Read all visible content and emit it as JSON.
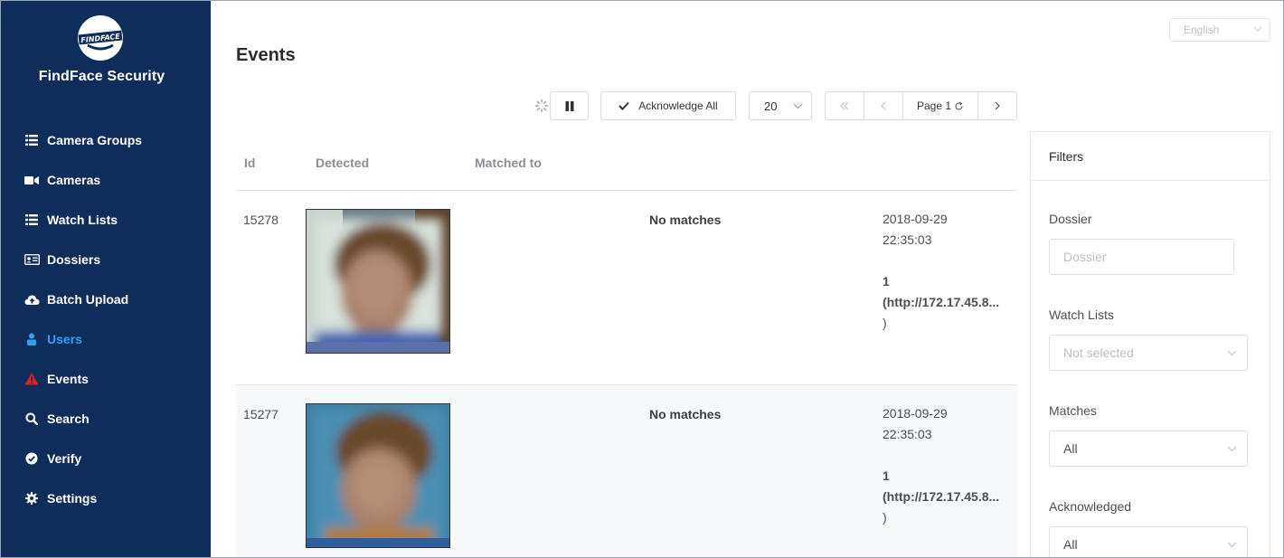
{
  "app": {
    "brand": "FindFace Security",
    "logo_text": "FINDFACE"
  },
  "sidebar": {
    "items": [
      {
        "label": "Camera Groups",
        "icon": "list-icon"
      },
      {
        "label": "Cameras",
        "icon": "video-camera-icon"
      },
      {
        "label": "Watch Lists",
        "icon": "list-icon"
      },
      {
        "label": "Dossiers",
        "icon": "id-card-icon"
      },
      {
        "label": "Batch Upload",
        "icon": "cloud-upload-icon"
      },
      {
        "label": "Users",
        "icon": "user-icon",
        "active": true
      },
      {
        "label": "Events",
        "icon": "warning-icon"
      },
      {
        "label": "Search",
        "icon": "search-icon"
      },
      {
        "label": "Verify",
        "icon": "check-circle-icon"
      },
      {
        "label": "Settings",
        "icon": "gear-icon"
      }
    ]
  },
  "header": {
    "title": "Events",
    "language": "English"
  },
  "toolbar": {
    "acknowledge_all": "Acknowledge All",
    "page_size": "20",
    "page_label": "Page 1"
  },
  "table": {
    "columns": [
      "Id",
      "Detected",
      "Matched to"
    ],
    "rows": [
      {
        "id": "15278",
        "match": "No matches",
        "date": "2018-09-29",
        "time": "22:35:03",
        "camera_id": "1",
        "camera_url": "(http://172.17.45.8...",
        "camera_close": ")"
      },
      {
        "id": "15277",
        "match": "No matches",
        "date": "2018-09-29",
        "time": "22:35:03",
        "camera_id": "1",
        "camera_url": "(http://172.17.45.8...",
        "camera_close": ")"
      }
    ]
  },
  "filters": {
    "title": "Filters",
    "dossier": {
      "label": "Dossier",
      "placeholder": "Dossier"
    },
    "watch_lists": {
      "label": "Watch Lists",
      "value": "Not selected"
    },
    "matches": {
      "label": "Matches",
      "value": "All"
    },
    "acknowledged": {
      "label": "Acknowledged",
      "value": "All"
    }
  },
  "colors": {
    "sidebar_bg": "#0f2d5a",
    "active": "#2ea3f2",
    "events_icon": "#e02020"
  }
}
